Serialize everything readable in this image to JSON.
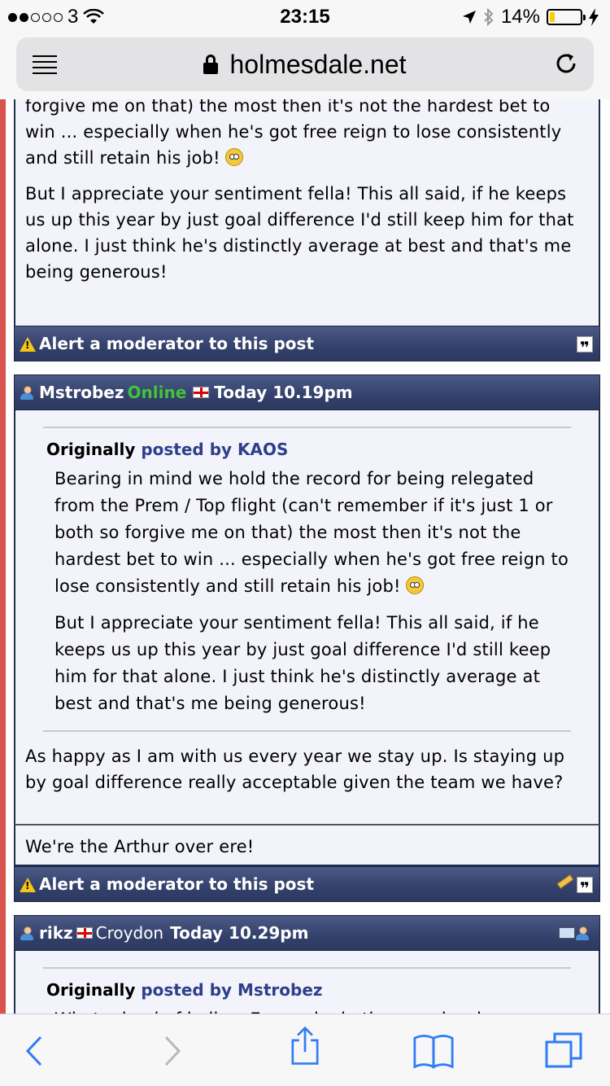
{
  "status_bar": {
    "carrier": "3",
    "time": "23:15",
    "battery": "14%"
  },
  "browser": {
    "url": "holmesdale.net"
  },
  "post1": {
    "cut_line": "forgive me on that) the most then it's not the hardest bet to",
    "p1": "win ... especially when he's got free reign to lose consistently and still retain his job!",
    "p2": "But I appreciate your sentiment fella! This all said, if he keeps us up this year by just goal difference I'd still keep him for that alone. I just think he's distinctly average at best and that's me being generous!",
    "alert": "Alert a moderator to this post"
  },
  "post2": {
    "username": "Mstrobez",
    "status": "Online",
    "date": "Today 10.19pm",
    "quote_label": "Originally",
    "quote_by": "posted by KAOS",
    "quote_p1": "Bearing in mind we hold the record for being relegated from the Prem / Top flight (can't remember if it's just 1 or both so forgive me on that) the most then it's not the hardest bet to win ... especially when he's got free reign to lose consistently and still retain his job!",
    "quote_p2": "But I appreciate your sentiment fella! This all said, if he keeps us up this year by just goal difference I'd still keep him for that alone. I just think he's distinctly average at best and that's me being generous!",
    "body": "As happy as I am with us every year we stay up. Is staying up by goal difference really acceptable given the team we have?",
    "signature": "We're the Arthur over ere!",
    "alert": "Alert a moderator to this post"
  },
  "post3": {
    "username": "rikz",
    "location": "Croydon",
    "date": "Today 10.29pm",
    "quote_label": "Originally",
    "quote_by": "posted by Mstrobez",
    "quote_cut": "What a load of bollox. Every single time pardew has"
  }
}
